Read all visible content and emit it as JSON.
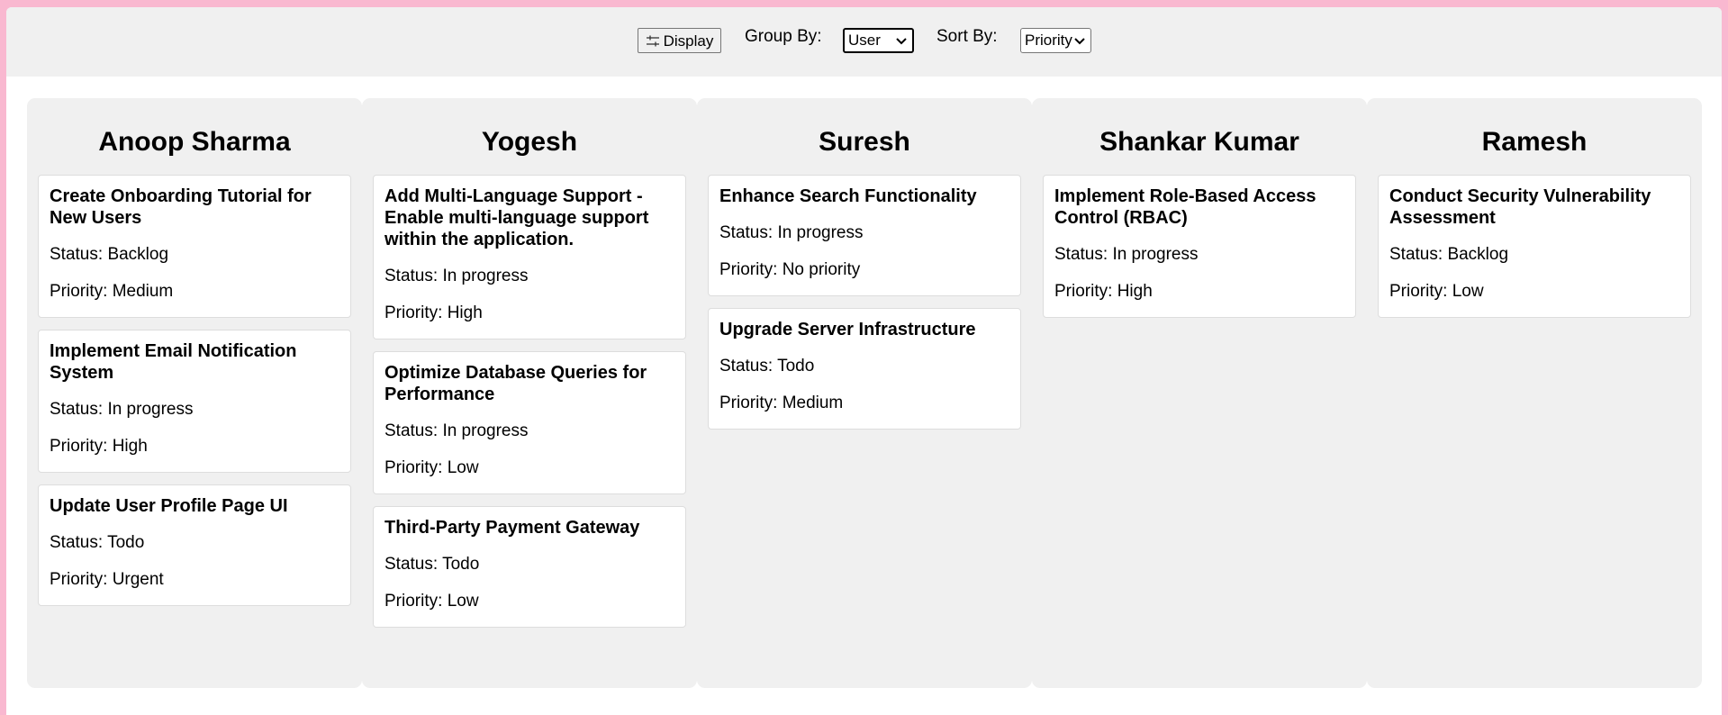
{
  "toolbar": {
    "display_label": "Display",
    "group_by_label": "Group By:",
    "group_by_value": "User",
    "sort_by_label": "Sort By:",
    "sort_by_value": "Priority"
  },
  "status_prefix": "Status:",
  "priority_prefix": "Priority:",
  "columns": [
    {
      "name": "Anoop Sharma",
      "cards": [
        {
          "title": "Create Onboarding Tutorial for New Users",
          "status": "Backlog",
          "priority": "Medium"
        },
        {
          "title": "Implement Email Notification System",
          "status": "In progress",
          "priority": "High"
        },
        {
          "title": "Update User Profile Page UI",
          "status": "Todo",
          "priority": "Urgent"
        }
      ]
    },
    {
      "name": "Yogesh",
      "cards": [
        {
          "title": "Add Multi-Language Support - Enable multi-language support within the application.",
          "status": "In progress",
          "priority": "High"
        },
        {
          "title": "Optimize Database Queries for Performance",
          "status": "In progress",
          "priority": "Low"
        },
        {
          "title": "Third-Party Payment Gateway",
          "status": "Todo",
          "priority": "Low"
        }
      ]
    },
    {
      "name": "Suresh",
      "cards": [
        {
          "title": "Enhance Search Functionality",
          "status": "In progress",
          "priority": "No priority"
        },
        {
          "title": "Upgrade Server Infrastructure",
          "status": "Todo",
          "priority": "Medium"
        }
      ]
    },
    {
      "name": "Shankar Kumar",
      "cards": [
        {
          "title": "Implement Role-Based Access Control (RBAC)",
          "status": "In progress",
          "priority": "High"
        }
      ]
    },
    {
      "name": "Ramesh",
      "cards": [
        {
          "title": "Conduct Security Vulnerability Assessment",
          "status": "Backlog",
          "priority": "Low"
        }
      ]
    }
  ]
}
